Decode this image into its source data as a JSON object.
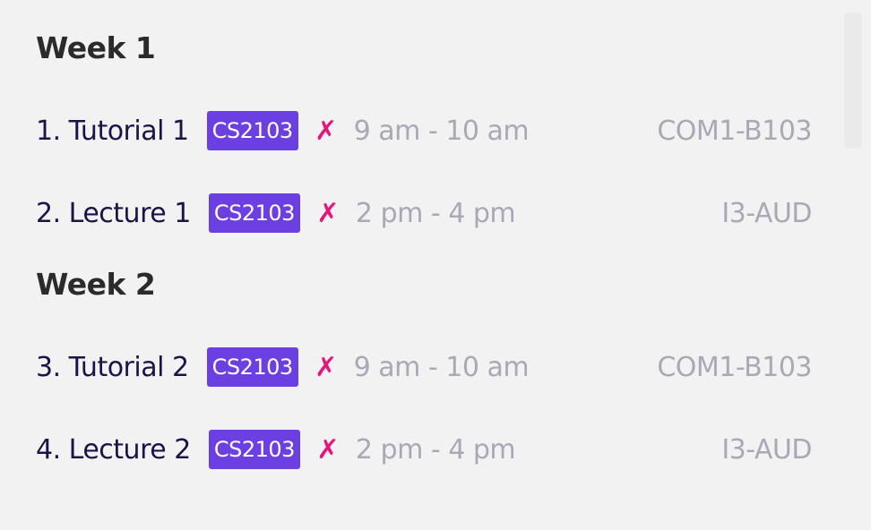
{
  "weeks": [
    {
      "header": "Week 1",
      "items": [
        {
          "title": "1. Tutorial 1",
          "module": "CS2103",
          "status_icon": "✗",
          "time": "9 am - 10 am",
          "venue": "COM1-B103"
        },
        {
          "title": "2. Lecture 1",
          "module": "CS2103",
          "status_icon": "✗",
          "time": "2 pm - 4 pm",
          "venue": "I3-AUD"
        }
      ]
    },
    {
      "header": "Week 2",
      "items": [
        {
          "title": "3. Tutorial 2",
          "module": "CS2103",
          "status_icon": "✗",
          "time": "9 am - 10 am",
          "venue": "COM1-B103"
        },
        {
          "title": "4. Lecture 2",
          "module": "CS2103",
          "status_icon": "✗",
          "time": "2 pm - 4 pm",
          "venue": "I3-AUD"
        }
      ]
    }
  ],
  "colors": {
    "background": "#f3f2f3",
    "badge": "#6c3fe3",
    "cross": "#e5157a",
    "muted_text": "#a9a9b6",
    "title_text": "#1b1446"
  }
}
